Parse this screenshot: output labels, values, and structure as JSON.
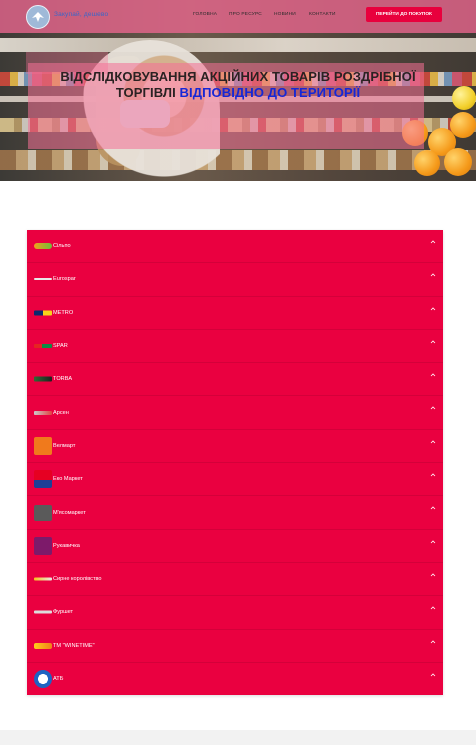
{
  "header": {
    "logo_text": "Закупай, дешево",
    "nav": [
      "Головна",
      "Про ресурс",
      "Новини",
      "Контакти"
    ],
    "cta": "Перейти до покупок"
  },
  "hero": {
    "title_part1": "ВІДСЛІДКОВУВАННЯ АКЦІЙНИХ ТОВАРІВ РОЗДРІБНОЇ ТОРГІВЛІ ",
    "title_accent": "ВІДПОВІДНО ДО ТЕРИТОРІЇ"
  },
  "colors": {
    "accent_red": "#ea0040",
    "nav_pink": "#ec6690",
    "title_blue": "#1627d6"
  },
  "stores": [
    {
      "label": "Сільпо",
      "icon": "silpo-logo-icon"
    },
    {
      "label": "Eurospar",
      "icon": "eurospar-logo-icon"
    },
    {
      "label": "METRO",
      "icon": "metro-logo-icon"
    },
    {
      "label": "SPAR",
      "icon": "spar-logo-icon"
    },
    {
      "label": "TORBA",
      "icon": "torba-logo-icon"
    },
    {
      "label": "Арсен",
      "icon": "arsen-logo-icon"
    },
    {
      "label": "Велмарт",
      "icon": "velmart-logo-icon"
    },
    {
      "label": "Еко Маркет",
      "icon": "eko-market-logo-icon"
    },
    {
      "label": "М'ясомаркет",
      "icon": "myasomarket-logo-icon"
    },
    {
      "label": "Рукавичка",
      "icon": "rukavychka-logo-icon"
    },
    {
      "label": "Сирне королівство",
      "icon": "syrne-korolivstvo-logo-icon"
    },
    {
      "label": "Фуршет",
      "icon": "furshet-logo-icon"
    },
    {
      "label": "ТМ \"WINETIME\"",
      "icon": "winetime-logo-icon"
    },
    {
      "label": "АТБ",
      "icon": "atb-logo-icon"
    }
  ]
}
